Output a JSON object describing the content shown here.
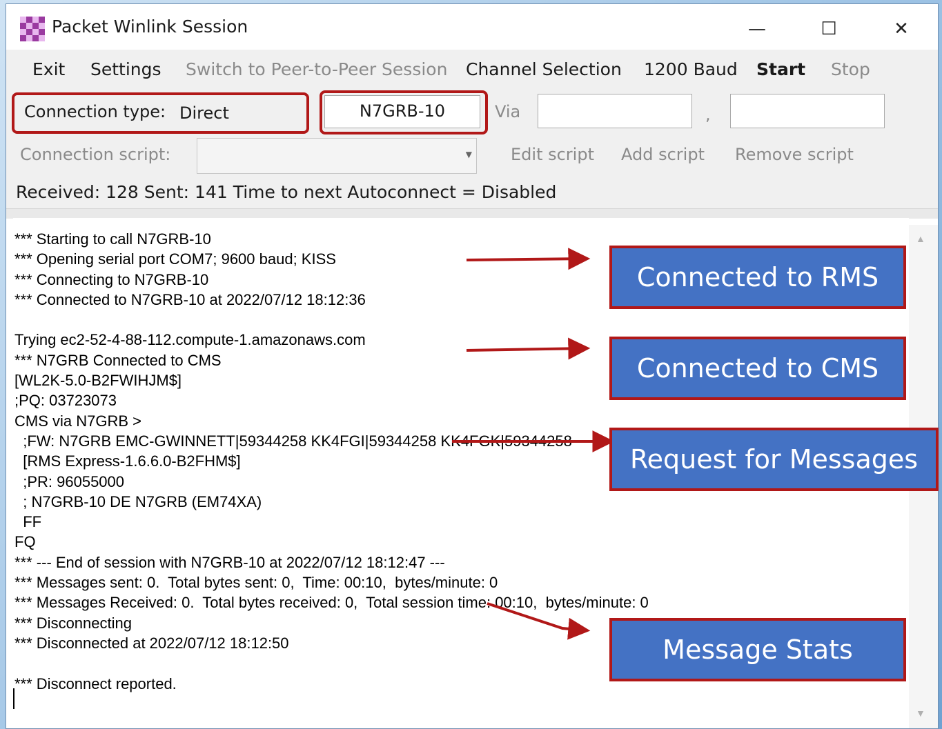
{
  "window": {
    "title": "Packet Winlink Session",
    "controls": {
      "minimize": "—",
      "maximize": "☐",
      "close": "✕"
    }
  },
  "menu": {
    "exit": "Exit",
    "settings": "Settings",
    "peer_to_peer": "Switch to Peer-to-Peer Session",
    "channel_selection": "Channel Selection",
    "baud": "1200 Baud",
    "start": "Start",
    "stop": "Stop"
  },
  "connection": {
    "type_label": "Connection type:",
    "type_value": "Direct",
    "callsign_value": "N7GRB-10",
    "via_label": "Via",
    "via_value_1": "",
    "via_separator": ",",
    "via_value_2": ""
  },
  "script": {
    "label": "Connection script:",
    "selected": "",
    "edit": "Edit script",
    "add": "Add script",
    "remove": "Remove script"
  },
  "status": {
    "text": "Received: 128  Sent: 141   Time to next Autoconnect = Disabled"
  },
  "log": {
    "text": "*** Starting to call N7GRB-10\n*** Opening serial port COM7; 9600 baud; KISS\n*** Connecting to N7GRB-10\n*** Connected to N7GRB-10 at 2022/07/12 18:12:36\n\nTrying ec2-52-4-88-112.compute-1.amazonaws.com\n*** N7GRB Connected to CMS\n[WL2K-5.0-B2FWIHJM$]\n;PQ: 03723073\nCMS via N7GRB >\n  ;FW: N7GRB EMC-GWINNETT|59344258 KK4FGI|59344258 KK4FGK|59344258\n  [RMS Express-1.6.6.0-B2FHM$]\n  ;PR: 96055000\n  ; N7GRB-10 DE N7GRB (EM74XA)\n  FF\nFQ\n*** --- End of session with N7GRB-10 at 2022/07/12 18:12:47 ---\n*** Messages sent: 0.  Total bytes sent: 0,  Time: 00:10,  bytes/minute: 0\n*** Messages Received: 0.  Total bytes received: 0,  Total session time: 00:10,  bytes/minute: 0\n*** Disconnecting\n*** Disconnected at 2022/07/12 18:12:50\n\n*** Disconnect reported."
  },
  "annotations": [
    {
      "label": "Connected to RMS"
    },
    {
      "label": "Connected to CMS"
    },
    {
      "label": "Request for Messages"
    },
    {
      "label": "Message Stats"
    }
  ],
  "colors": {
    "callout_fill": "#4472c4",
    "callout_border": "#b11818",
    "highlight_border": "#b11818",
    "arrow": "#b11818"
  }
}
